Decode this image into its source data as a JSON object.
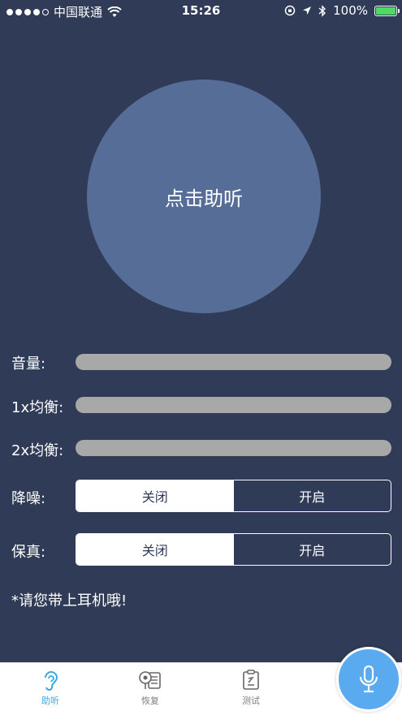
{
  "status_bar": {
    "carrier": "中国联通",
    "time": "15:26",
    "battery": "100%"
  },
  "main": {
    "circle_label": "点击助听",
    "volume_label": "音量:",
    "eq1_label": "1x均衡:",
    "eq2_label": "2x均衡:",
    "noise_label": "降噪:",
    "noise_off": "关闭",
    "noise_on": "开启",
    "noise_selected": "关闭",
    "fidelity_label": "保真:",
    "fidelity_off": "关闭",
    "fidelity_on": "开启",
    "fidelity_selected": "关闭",
    "notice": "*请您带上耳机哦!"
  },
  "tabs": [
    {
      "label": "助听",
      "icon": "ear-icon",
      "active": true
    },
    {
      "label": "恢复",
      "icon": "recovery-icon",
      "active": false
    },
    {
      "label": "测试",
      "icon": "test-clipboard-icon",
      "active": false
    }
  ],
  "colors": {
    "background": "#2f3b57",
    "circle": "#566d98",
    "slider": "#a8a8a8",
    "accent": "#3aa7e6",
    "fab": "#5aaaf0",
    "battery": "#4cd964"
  },
  "fab": {
    "icon": "microphone-icon"
  }
}
